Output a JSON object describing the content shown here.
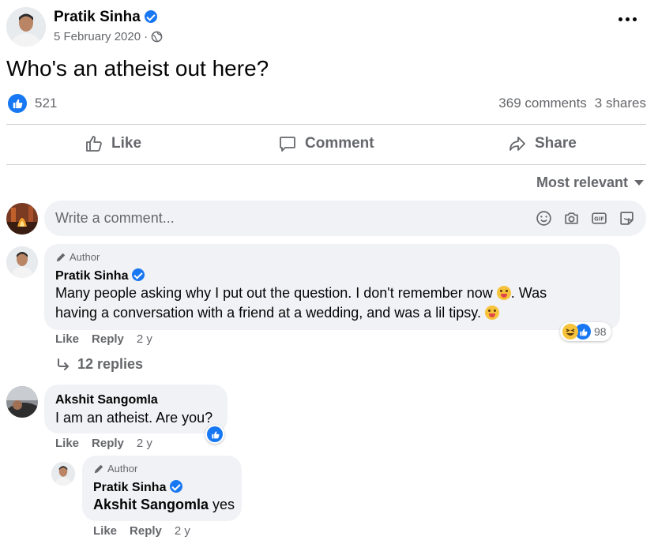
{
  "post": {
    "author": "Pratik Sinha",
    "date": "5 February 2020",
    "date_sep": "·",
    "text": "Who's an atheist out here?",
    "like_count": "521",
    "comments": "369 comments",
    "shares": "3 shares",
    "more_icon": "more-horizontal-icon",
    "privacy_icon": "globe-icon"
  },
  "actions": {
    "like": "Like",
    "comment": "Comment",
    "share": "Share"
  },
  "sort": {
    "label": "Most relevant"
  },
  "composer": {
    "placeholder": "Write a comment...",
    "icons": [
      "emoji-icon",
      "camera-icon",
      "gif-icon",
      "sticker-icon"
    ]
  },
  "comments": [
    {
      "badge": "Author",
      "name": "Pratik Sinha",
      "text_line1": "Many people asking why I put out the question. I don't remember now",
      "text_line1_end": ". Was",
      "text_line2": "having a conversation with a friend at a wedding, and was a lil tipsy.",
      "reaction_count": "98",
      "like": "Like",
      "reply": "Reply",
      "time": "2 y",
      "replies_label": "12 replies"
    },
    {
      "name": "Akshit Sangomla",
      "text": "I am an atheist. Are you?",
      "like": "Like",
      "reply": "Reply",
      "time": "2 y"
    },
    {
      "badge": "Author",
      "name": "Pratik Sinha",
      "mention": "Akshit Sangomla",
      "text": "yes",
      "like": "Like",
      "reply": "Reply",
      "time": "2 y"
    }
  ],
  "colors": {
    "accent": "#1877f2",
    "muted": "#65676b",
    "bubble": "#f0f2f5"
  }
}
